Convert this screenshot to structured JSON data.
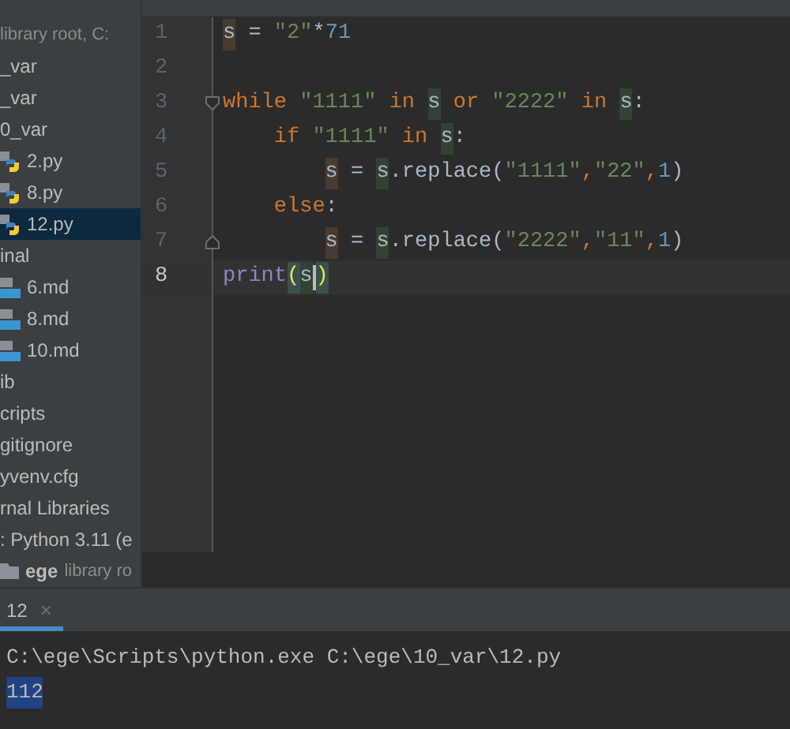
{
  "sidebar": {
    "items": [
      {
        "label": "library root, C:",
        "kind": "hint",
        "selected": false
      },
      {
        "label": "_var",
        "kind": "folder",
        "selected": false
      },
      {
        "label": "_var",
        "kind": "folder",
        "selected": false
      },
      {
        "label": "0_var",
        "kind": "folder",
        "selected": false
      },
      {
        "label": "2.py",
        "kind": "python",
        "selected": false
      },
      {
        "label": "8.py",
        "kind": "python",
        "selected": false
      },
      {
        "label": "12.py",
        "kind": "python",
        "selected": true
      },
      {
        "label": "inal",
        "kind": "folder",
        "selected": false
      },
      {
        "label": "6.md",
        "kind": "markdown",
        "selected": false
      },
      {
        "label": "8.md",
        "kind": "markdown",
        "selected": false
      },
      {
        "label": "10.md",
        "kind": "markdown",
        "selected": false
      },
      {
        "label": "ib",
        "kind": "folder",
        "selected": false
      },
      {
        "label": "cripts",
        "kind": "folder",
        "selected": false
      },
      {
        "label": "gitignore",
        "kind": "folder",
        "selected": false
      },
      {
        "label": "yvenv.cfg",
        "kind": "folder",
        "selected": false
      },
      {
        "label": "rnal Libraries",
        "kind": "folder",
        "selected": false
      },
      {
        "label": ": Python 3.11 (e",
        "kind": "folder",
        "selected": false
      },
      {
        "label": "ege",
        "hint": "library ro",
        "kind": "root",
        "selected": false
      }
    ]
  },
  "editor": {
    "lines": [
      {
        "number": "1",
        "current": false,
        "tokens": [
          {
            "text": "s",
            "kind": "write"
          },
          {
            "text": " = ",
            "kind": "plain"
          },
          {
            "text": "\"2\"",
            "kind": "string"
          },
          {
            "text": "*",
            "kind": "plain"
          },
          {
            "text": "71",
            "kind": "number"
          }
        ]
      },
      {
        "number": "2",
        "current": false
      },
      {
        "number": "3",
        "current": false,
        "fold_start": true,
        "tokens": [
          {
            "text": "while ",
            "kind": "keyword"
          },
          {
            "text": "\"1111\" ",
            "kind": "string"
          },
          {
            "text": "in ",
            "kind": "keyword"
          },
          {
            "text": "s",
            "kind": "read"
          },
          {
            "text": " or ",
            "kind": "keyword"
          },
          {
            "text": "\"2222\" ",
            "kind": "string"
          },
          {
            "text": "in ",
            "kind": "keyword"
          },
          {
            "text": "s",
            "kind": "read"
          },
          {
            "text": ":",
            "kind": "plain"
          }
        ],
        "children": [
          {
            "number": "4",
            "current": false,
            "tokens": [
              {
                "text": "if ",
                "kind": "keyword"
              },
              {
                "text": "\"1111\" ",
                "kind": "string"
              },
              {
                "text": "in ",
                "kind": "keyword"
              },
              {
                "text": "s",
                "kind": "read"
              },
              {
                "text": ":",
                "kind": "plain"
              }
            ],
            "children": [
              {
                "number": "5",
                "current": false,
                "tokens": [
                  {
                    "text": "s",
                    "kind": "write"
                  },
                  {
                    "text": " = ",
                    "kind": "plain"
                  },
                  {
                    "text": "s",
                    "kind": "read"
                  },
                  {
                    "text": ".replace(",
                    "kind": "plain"
                  },
                  {
                    "text": "\"1111\"",
                    "kind": "string"
                  },
                  {
                    "text": ",",
                    "kind": "keyword"
                  },
                  {
                    "text": "\"22\"",
                    "kind": "string"
                  },
                  {
                    "text": ",",
                    "kind": "keyword"
                  },
                  {
                    "text": "1",
                    "kind": "number"
                  },
                  {
                    "text": ")",
                    "kind": "plain"
                  }
                ]
              }
            ]
          },
          {
            "number": "6",
            "current": false,
            "tokens": [
              {
                "text": "else",
                "kind": "keyword"
              },
              {
                "text": ":",
                "kind": "plain"
              }
            ],
            "children": [
              {
                "number": "7",
                "current": false,
                "fold_end": true,
                "tokens": [
                  {
                    "text": "s",
                    "kind": "write"
                  },
                  {
                    "text": " = ",
                    "kind": "plain"
                  },
                  {
                    "text": "s",
                    "kind": "read"
                  },
                  {
                    "text": ".replace(",
                    "kind": "plain"
                  },
                  {
                    "text": "\"2222\"",
                    "kind": "string"
                  },
                  {
                    "text": ",",
                    "kind": "keyword"
                  },
                  {
                    "text": "\"11\"",
                    "kind": "string"
                  },
                  {
                    "text": ",",
                    "kind": "keyword"
                  },
                  {
                    "text": "1",
                    "kind": "number"
                  },
                  {
                    "text": ")",
                    "kind": "plain"
                  }
                ]
              }
            ]
          }
        ]
      },
      {
        "number": "8",
        "current": true,
        "tokens": [
          {
            "text": "print",
            "kind": "builtin"
          },
          {
            "text": "(",
            "kind": "paren"
          },
          {
            "text": "s",
            "kind": "read"
          },
          {
            "text": ")",
            "kind": "paren",
            "caret": true
          }
        ]
      }
    ]
  },
  "run_panel": {
    "tabs": [
      {
        "label": "12",
        "close": "×",
        "selected": true
      }
    ],
    "output": [
      {
        "text": "C:\\ege\\Scripts\\python.exe C:\\ege\\10_var\\12.py",
        "selected": false
      },
      {
        "text": "112",
        "selected": true
      }
    ]
  }
}
